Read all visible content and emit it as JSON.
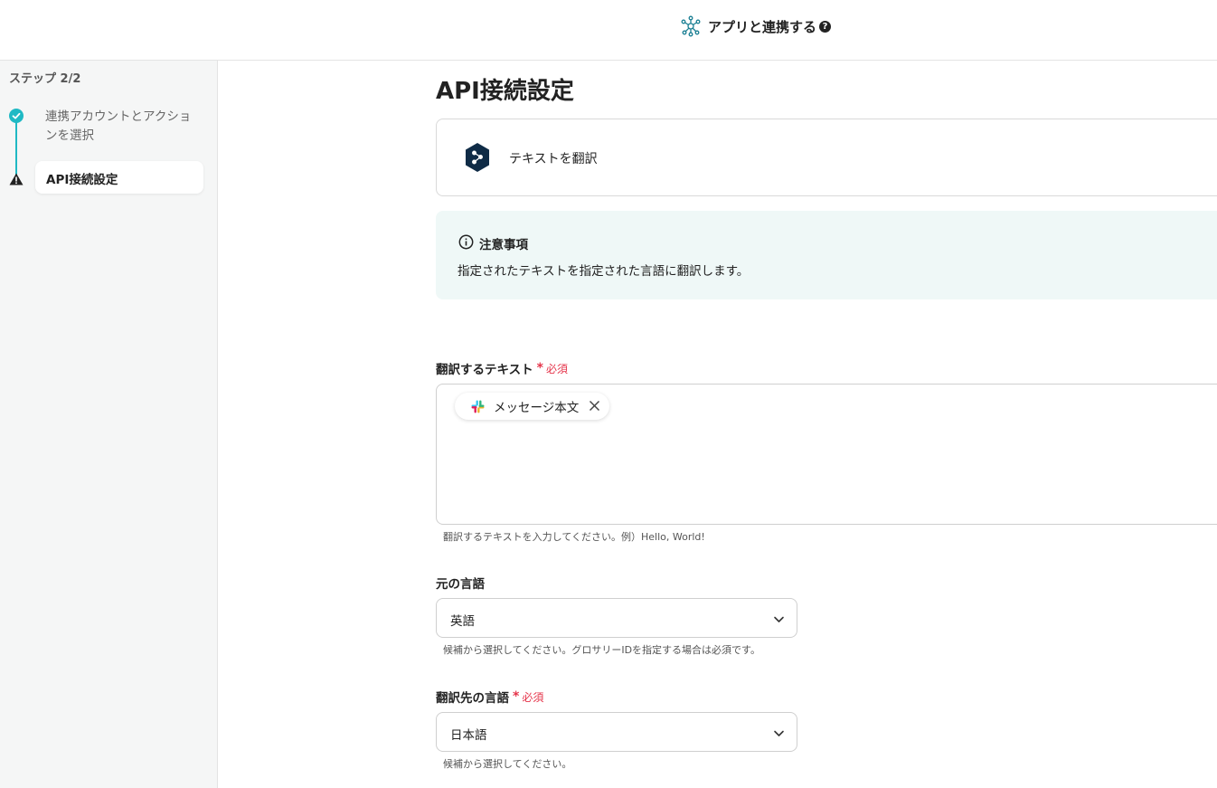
{
  "header": {
    "title": "アプリと連携する",
    "icon": "network-icon",
    "help_icon": "?"
  },
  "sidebar": {
    "step_count": "ステップ 2/2",
    "steps": [
      {
        "label": "連携アカウントとアクションを選択",
        "status": "done"
      },
      {
        "label": "API接続設定",
        "status": "warning"
      }
    ]
  },
  "main": {
    "title": "API接続設定",
    "action": {
      "label": "テキストを翻訳",
      "icon": "deepl-icon"
    },
    "notice": {
      "title": "注意事項",
      "text": "指定されたテキストを指定された言語に翻訳します。"
    },
    "fields": {
      "text": {
        "label": "翻訳するテキスト",
        "required_mark": "*",
        "required_text": "必須",
        "chip_label": "メッセージ本文",
        "hint": "翻訳するテキストを入力してください。例）Hello, World!"
      },
      "source_lang": {
        "label": "元の言語",
        "value": "英語",
        "hint": "候補から選択してください。グロサリーIDを指定する場合は必須です。"
      },
      "target_lang": {
        "label": "翻訳先の言語",
        "required_mark": "*",
        "required_text": "必須",
        "value": "日本語",
        "hint": "候補から選択してください。"
      }
    }
  },
  "colors": {
    "accent": "#1fb9c4",
    "required": "#e5344a",
    "notice_bg": "#eff8f7"
  }
}
